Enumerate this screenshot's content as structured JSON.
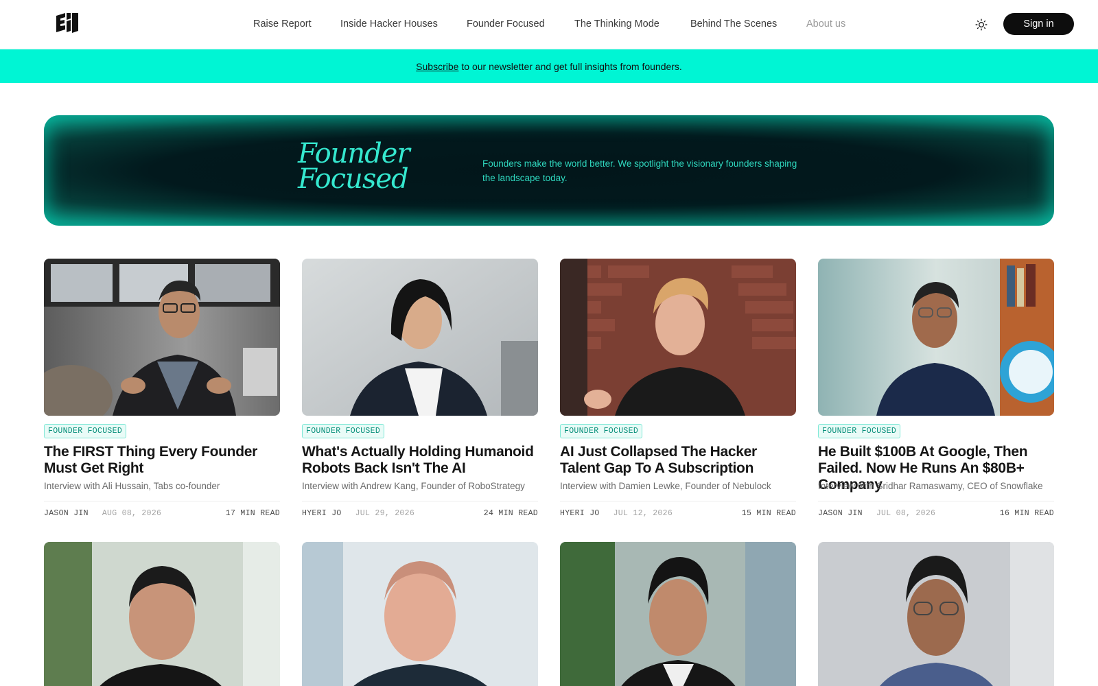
{
  "header": {
    "logo": "site-logo",
    "nav": [
      {
        "label": "Raise Report"
      },
      {
        "label": "Inside Hacker Houses"
      },
      {
        "label": "Founder Focused"
      },
      {
        "label": "The Thinking Mode"
      },
      {
        "label": "Behind The Scenes"
      },
      {
        "label": "About us"
      }
    ],
    "theme_icon": "sun-icon",
    "signin_label": "Sign in"
  },
  "subscribe_bar": {
    "link_label": "Subscribe",
    "text": "to our newsletter and get full insights from founders.",
    "background": "#00f5d4"
  },
  "hero": {
    "title_line1": "Founder",
    "title_line2": "Focused",
    "description": "Founders make the world better. We spotlight the visionary founders shaping the landscape today.",
    "accent": "#35e8cf"
  },
  "articles": [
    {
      "tag": "FOUNDER FOCUSED",
      "title": "The FIRST Thing Every Founder Must Get Right",
      "subtitle": "Interview with Ali Hussain, Tabs co-founder",
      "author": "JASON JIN",
      "date": "AUG 08, 2026",
      "read_time": "17 MIN READ"
    },
    {
      "tag": "FOUNDER FOCUSED",
      "title": "What's Actually Holding Humanoid Robots Back Isn't The AI",
      "subtitle": "Interview with Andrew Kang, Founder of RoboStrategy",
      "author": "HYERI JO",
      "date": "JUL 29, 2026",
      "read_time": "24 MIN READ"
    },
    {
      "tag": "FOUNDER FOCUSED",
      "title": "AI Just Collapsed The Hacker Talent Gap To A Subscription",
      "subtitle": "Interview with Damien Lewke, Founder of Nebulock",
      "author": "HYERI JO",
      "date": "JUL 12, 2026",
      "read_time": "15 MIN READ"
    },
    {
      "tag": "FOUNDER FOCUSED",
      "title": "He Built $100B At Google, Then Failed. Now He Runs An $80B+ Company",
      "subtitle": "Interview with Sridhar Ramaswamy, CEO of Snowflake",
      "author": "JASON JIN",
      "date": "JUL 08, 2026",
      "read_time": "16 MIN READ"
    }
  ]
}
